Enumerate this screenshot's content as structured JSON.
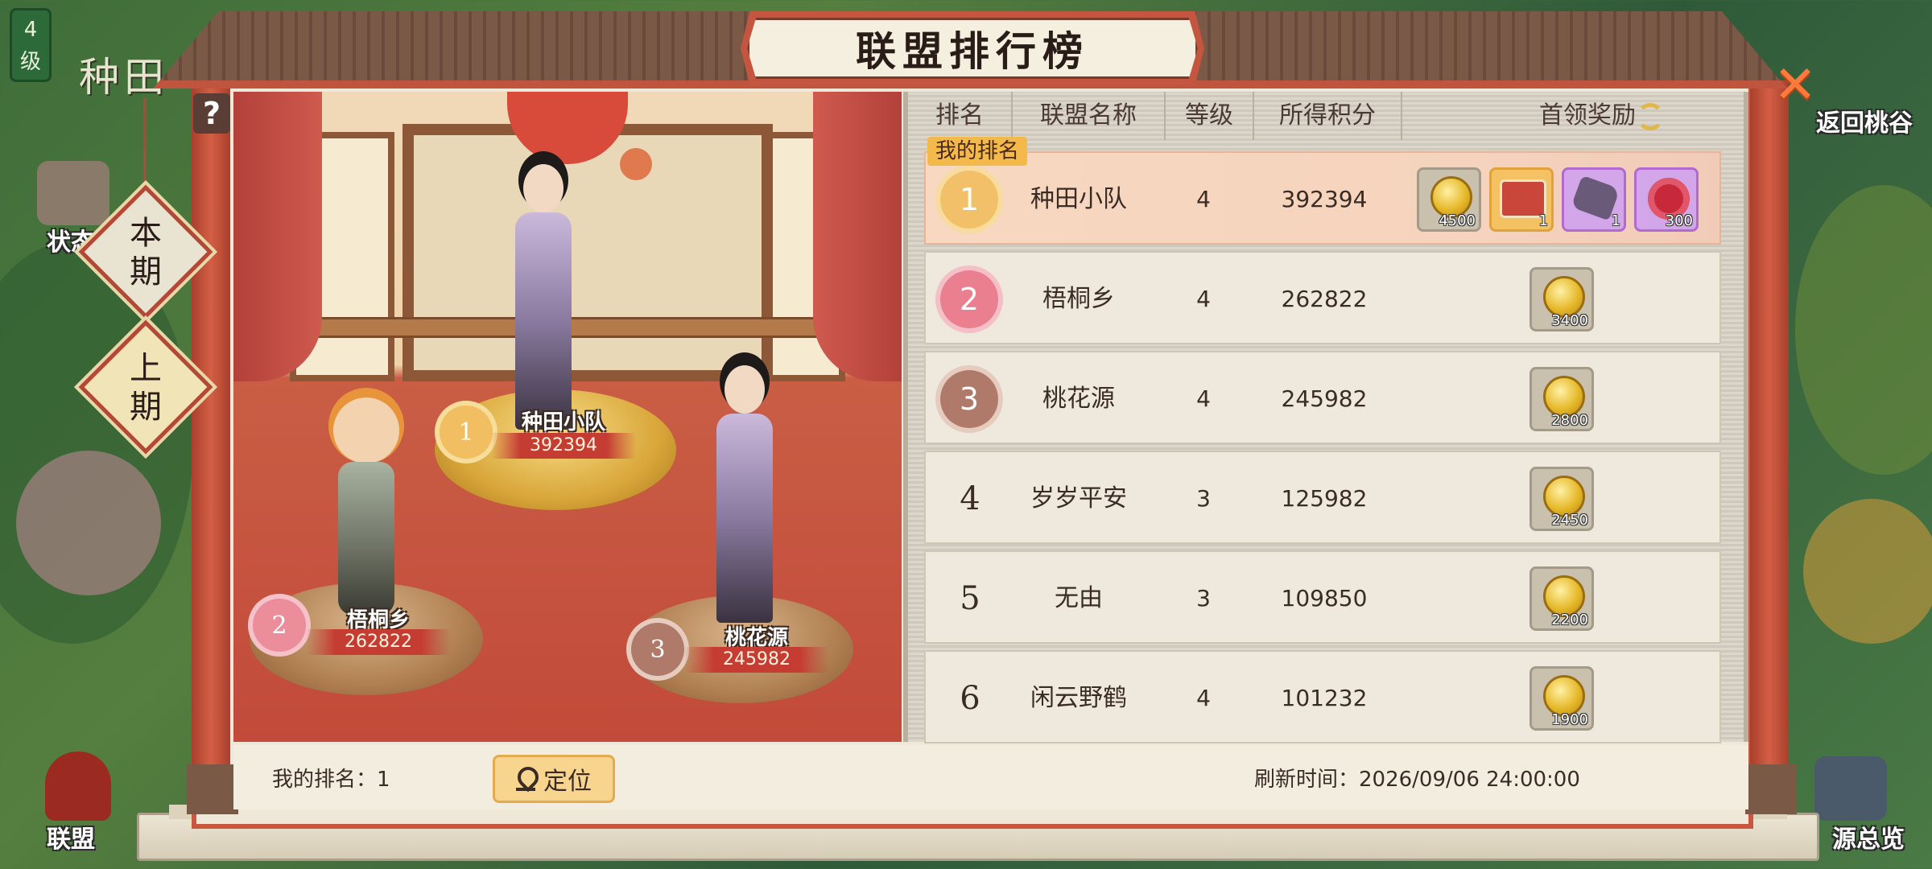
{
  "hud": {
    "level_badge": "4\n级",
    "town_name": "种田",
    "left_label_1": "状态",
    "left_label_2": "联盟",
    "right_label_1": "返回桃谷",
    "right_label_2": "源总览"
  },
  "panel": {
    "title": "联盟排行榜",
    "tabs": [
      {
        "label": "本期",
        "active": false
      },
      {
        "label": "上期",
        "active": true
      }
    ]
  },
  "podium": [
    {
      "rank": "1",
      "name": "种田小队",
      "score": "392394"
    },
    {
      "rank": "2",
      "name": "梧桐乡",
      "score": "262822"
    },
    {
      "rank": "3",
      "name": "桃花源",
      "score": "245982"
    }
  ],
  "table": {
    "headers": [
      "排名",
      "联盟名称",
      "等级",
      "所得积分",
      "首领奖励"
    ],
    "my_rank_tag": "我的排名",
    "rows": [
      {
        "rank": "1",
        "name": "种田小队",
        "level": "4",
        "score": "392394",
        "rewards": [
          {
            "icon": "gold-coin-icon",
            "qty": "4500"
          },
          {
            "icon": "title-card-icon",
            "qty": "1"
          },
          {
            "icon": "ore-stone-icon",
            "qty": "1"
          },
          {
            "icon": "plum-blossom-icon",
            "qty": "300"
          }
        ]
      },
      {
        "rank": "2",
        "name": "梧桐乡",
        "level": "4",
        "score": "262822",
        "rewards": [
          {
            "icon": "gold-coin-icon",
            "qty": "3400"
          }
        ]
      },
      {
        "rank": "3",
        "name": "桃花源",
        "level": "4",
        "score": "245982",
        "rewards": [
          {
            "icon": "gold-coin-icon",
            "qty": "2800"
          }
        ]
      },
      {
        "rank": "4",
        "name": "岁岁平安",
        "level": "3",
        "score": "125982",
        "rewards": [
          {
            "icon": "gold-coin-icon",
            "qty": "2450"
          }
        ]
      },
      {
        "rank": "5",
        "name": "无由",
        "level": "3",
        "score": "109850",
        "rewards": [
          {
            "icon": "gold-coin-icon",
            "qty": "2200"
          }
        ]
      },
      {
        "rank": "6",
        "name": "闲云野鹤",
        "level": "4",
        "score": "101232",
        "rewards": [
          {
            "icon": "gold-coin-icon",
            "qty": "1900"
          }
        ]
      }
    ]
  },
  "footer": {
    "my_rank_label": "我的排名：1",
    "locate_label": "定位",
    "refresh_time": "刷新时间：2026/09/06 24:00:00"
  },
  "colors": {
    "frame_red": "#c9573f",
    "gold": "#e6b92a",
    "rank1": "#f3c06a",
    "rank2": "#e97f8f",
    "rank3": "#b07a6a"
  }
}
